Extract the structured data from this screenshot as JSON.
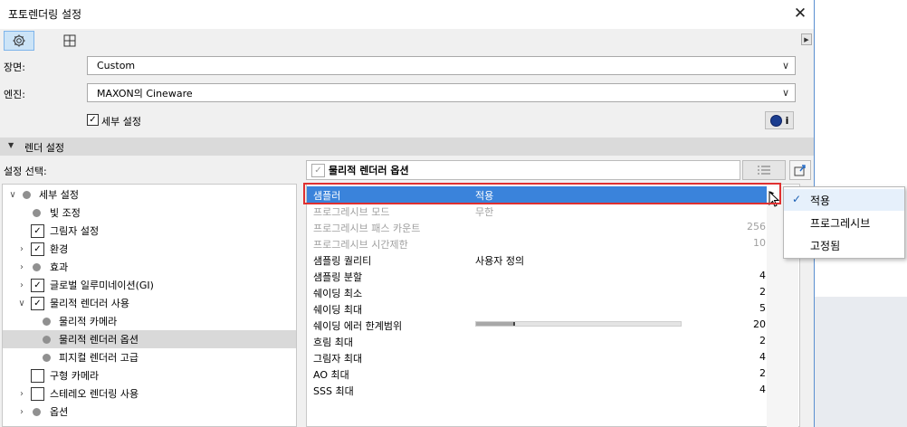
{
  "window": {
    "title": "포토렌더링 설정",
    "close_glyph": "✕"
  },
  "toolbar": {
    "expand_glyph": "▶"
  },
  "scene": {
    "label": "장면:",
    "value": "Custom"
  },
  "engine": {
    "label": "엔진:",
    "value": "MAXON의 Cineware"
  },
  "detail": {
    "label": "세부 설정",
    "checked": true,
    "info_glyph": "i"
  },
  "section": {
    "label": "렌더 설정",
    "arrow": "▼"
  },
  "select_settings": {
    "label": "설정 선택:"
  },
  "tree": [
    {
      "label": "세부 설정",
      "expander": "∨",
      "marker": "dot"
    },
    {
      "label": "빛 조정",
      "expander": "",
      "marker": "dot"
    },
    {
      "label": "그림자 설정",
      "expander": "",
      "marker": "check"
    },
    {
      "label": "환경",
      "expander": "›",
      "marker": "check"
    },
    {
      "label": "효과",
      "expander": "›",
      "marker": "dot"
    },
    {
      "label": "글로벌 일루미네이션(GI)",
      "expander": "›",
      "marker": "check"
    },
    {
      "label": "물리적 렌더러 사용",
      "expander": "∨",
      "marker": "check"
    },
    {
      "label": "물리적 카메라",
      "expander": "",
      "marker": "dot"
    },
    {
      "label": "물리적 렌더러 옵션",
      "expander": "",
      "marker": "dot"
    },
    {
      "label": "피지컬 렌더러 고급",
      "expander": "",
      "marker": "dot"
    },
    {
      "label": "구형 카메라",
      "expander": "",
      "marker": "box"
    },
    {
      "label": "스테레오 렌더링 사용",
      "expander": "›",
      "marker": "box"
    },
    {
      "label": "옵션",
      "expander": "›",
      "marker": "dot"
    }
  ],
  "panel": {
    "title": "물리적 렌더러 옵션"
  },
  "properties": [
    {
      "name": "샘플러",
      "value": "적용",
      "num": "",
      "state": "selected"
    },
    {
      "name": "프로그레시브 모드",
      "value": "무한",
      "num": "",
      "state": "disabled"
    },
    {
      "name": "프로그레시브 패스 카운트",
      "value": "",
      "num": "256",
      "state": "disabled"
    },
    {
      "name": "프로그레시브 시간제한",
      "value": "",
      "num": "10",
      "state": "disabled"
    },
    {
      "name": "샘플링 퀄리티",
      "value": "사용자 정의",
      "num": "",
      "state": "normal"
    },
    {
      "name": "샘플링 분할",
      "value": "",
      "num": "4",
      "state": "normal"
    },
    {
      "name": "쉐이딩 최소",
      "value": "",
      "num": "2",
      "state": "normal"
    },
    {
      "name": "쉐이딩 최대",
      "value": "",
      "num": "5",
      "state": "normal"
    },
    {
      "name": "쉐이딩 에러 한계범위",
      "value": "",
      "num": "20",
      "state": "normal",
      "slider": 0.19
    },
    {
      "name": "흐림 최대",
      "value": "",
      "num": "2",
      "state": "normal"
    },
    {
      "name": "그림자 최대",
      "value": "",
      "num": "4",
      "state": "normal"
    },
    {
      "name": "AO 최대",
      "value": "",
      "num": "2",
      "state": "normal"
    },
    {
      "name": "SSS 최대",
      "value": "",
      "num": "4",
      "state": "normal"
    }
  ],
  "popup_menu": [
    {
      "label": "적용",
      "checked": true
    },
    {
      "label": "프로그레시브",
      "checked": false
    },
    {
      "label": "고정됨",
      "checked": false
    }
  ],
  "colors": {
    "selection": "#3a83db",
    "highlight_box": "#e03030",
    "tree_selection": "#d9d9d9"
  }
}
